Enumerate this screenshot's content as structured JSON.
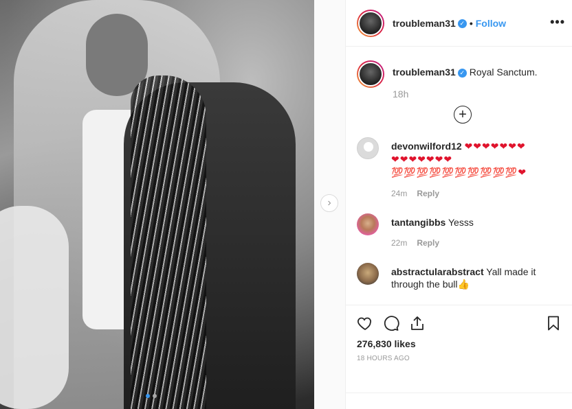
{
  "post": {
    "username": "troubleman31",
    "separator": "•",
    "follow_label": "Follow",
    "more_label": "•••",
    "verified_mark": "✓",
    "icons": {
      "verified": "verified-badge-icon",
      "more": "more-options-icon",
      "next": "chevron-right-icon",
      "load_more": "plus-circle-icon",
      "like": "heart-icon",
      "comment": "comment-bubble-icon",
      "share": "share-icon",
      "save": "bookmark-icon"
    },
    "colors": {
      "accent": "#3897f0",
      "text": "#262626",
      "muted": "#999999",
      "heart": "#e0142d"
    }
  },
  "caption": {
    "username": "troubleman31",
    "text": "Royal Sanctum.",
    "time": "18h",
    "load_more_symbol": "+"
  },
  "comments": [
    {
      "username": "devonwilford12",
      "line1": "❤❤❤❤❤❤❤",
      "line2": "❤❤❤❤❤❤❤",
      "line3": "💯💯💯💯💯💯💯💯💯💯❤",
      "time": "24m",
      "reply_label": "Reply"
    },
    {
      "username": "tantangibbs",
      "text": "Yesss",
      "time": "22m",
      "reply_label": "Reply"
    },
    {
      "username": "abstractularabstract",
      "text": "Yall made it through the bull👍"
    }
  ],
  "stats": {
    "likes": "276,830 likes",
    "posted": "18 HOURS AGO"
  },
  "carousel": {
    "next_symbol": "›",
    "current_index": 1,
    "total": 2
  }
}
